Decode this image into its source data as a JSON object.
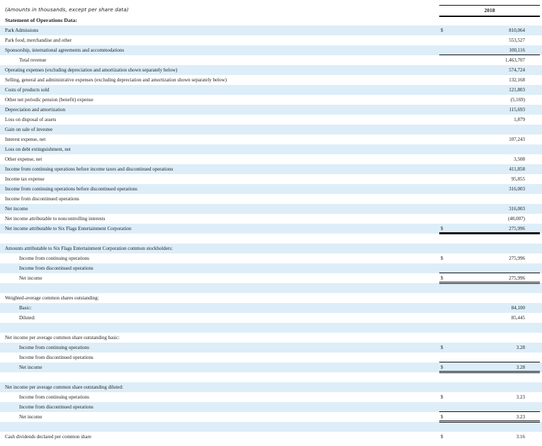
{
  "header": {
    "note": "(Amounts in thousands, except per share data)",
    "year": "2018",
    "section_title": "Statement of Operations Data:"
  },
  "rows": [
    {
      "label": "Park Admissions",
      "currency": "$",
      "value": "810,064",
      "shade": true,
      "indent": 0
    },
    {
      "label": "Park food, merchandise and other",
      "currency": "",
      "value": "553,527",
      "shade": false,
      "indent": 0
    },
    {
      "label": "Sponsorship, international agreements and accommodations",
      "currency": "",
      "value": "100,116",
      "shade": true,
      "indent": 0
    },
    {
      "label": "Total revenue",
      "currency": "",
      "value": "1,463,707",
      "shade": false,
      "indent": 1
    },
    {
      "label": "Operating expenses (excluding depreciation and amortization shown separately below)",
      "currency": "",
      "value": "574,724",
      "shade": true,
      "indent": 0
    },
    {
      "label": "Selling, general and administrative expenses (excluding depreciation and amortization shown separately below)",
      "currency": "",
      "value": "132,168",
      "shade": false,
      "indent": 0
    },
    {
      "label": "Costs of products sold",
      "currency": "",
      "value": "121,803",
      "shade": true,
      "indent": 0
    },
    {
      "label": "Other net periodic pension (benefit) expense",
      "currency": "",
      "value": "(5,169)",
      "shade": false,
      "indent": 0
    },
    {
      "label": "Depreciation and amortization",
      "currency": "",
      "value": "115,693",
      "shade": true,
      "indent": 0
    },
    {
      "label": "Loss on disposal of assets",
      "currency": "",
      "value": "1,879",
      "shade": false,
      "indent": 0
    },
    {
      "label": "Gain on sale of investee",
      "currency": "",
      "value": "",
      "shade": true,
      "indent": 0
    },
    {
      "label": "Interest expense, net",
      "currency": "",
      "value": "107,243",
      "shade": false,
      "indent": 0
    },
    {
      "label": "Loss on debt extinguishment, net",
      "currency": "",
      "value": "",
      "shade": true,
      "indent": 0
    },
    {
      "label": "Other expense, net",
      "currency": "",
      "value": "3,508",
      "shade": false,
      "indent": 0
    },
    {
      "label": "Income from continuing operations before income taxes and discontinued operations",
      "currency": "",
      "value": "411,858",
      "shade": true,
      "indent": 0
    },
    {
      "label": "Income tax expense",
      "currency": "",
      "value": "95,855",
      "shade": false,
      "indent": 0
    },
    {
      "label": "Income from continuing operations before discontinued operations",
      "currency": "",
      "value": "316,003",
      "shade": true,
      "indent": 0
    },
    {
      "label": "Income from discontinued operations",
      "currency": "",
      "value": "",
      "shade": false,
      "indent": 0
    },
    {
      "label": "Net income",
      "currency": "",
      "value": "316,003",
      "shade": true,
      "indent": 0
    },
    {
      "label": "Net income attributable to noncontrolling interests",
      "currency": "",
      "value": "(40,007)",
      "shade": false,
      "indent": 0
    },
    {
      "label": "Net income attributable to Six Flags Entertainment Corporation",
      "currency": "$",
      "value": "275,996",
      "shade": true,
      "indent": 0
    },
    {
      "label": "",
      "currency": "",
      "value": "",
      "shade": false,
      "indent": 0
    },
    {
      "label": "Amounts attributable to Six Flags Entertainment Corporation common stockholders:",
      "currency": "",
      "value": "",
      "shade": true,
      "indent": 0
    },
    {
      "label": "Income from continuing operations",
      "currency": "$",
      "value": "275,996",
      "shade": false,
      "indent": 1
    },
    {
      "label": "Income from discontinued operations",
      "currency": "",
      "value": "",
      "shade": true,
      "indent": 1
    },
    {
      "label": "Net income",
      "currency": "$",
      "value": "275,996",
      "shade": false,
      "indent": 1
    },
    {
      "label": "",
      "currency": "",
      "value": "",
      "shade": true,
      "indent": 0
    },
    {
      "label": "Weighted-average common shares outstanding:",
      "currency": "",
      "value": "",
      "shade": false,
      "indent": 0
    },
    {
      "label": "Basic:",
      "currency": "",
      "value": "84,100",
      "shade": true,
      "indent": 1
    },
    {
      "label": "Diluted:",
      "currency": "",
      "value": "85,445",
      "shade": false,
      "indent": 1
    },
    {
      "label": "",
      "currency": "",
      "value": "",
      "shade": true,
      "indent": 0
    },
    {
      "label": "Net income per average common share outstanding   basic:",
      "currency": "",
      "value": "",
      "shade": false,
      "indent": 0
    },
    {
      "label": "Income from continuing operations",
      "currency": "$",
      "value": "3.28",
      "shade": true,
      "indent": 1
    },
    {
      "label": "Income from discontinued operations",
      "currency": "",
      "value": "",
      "shade": false,
      "indent": 1
    },
    {
      "label": "Net income",
      "currency": "$",
      "value": "3.28",
      "shade": true,
      "indent": 1
    },
    {
      "label": "",
      "currency": "",
      "value": "",
      "shade": false,
      "indent": 0
    },
    {
      "label": "Net income per average common share outstanding   diluted:",
      "currency": "",
      "value": "",
      "shade": true,
      "indent": 0
    },
    {
      "label": "Income from continuing operations",
      "currency": "$",
      "value": "3.23",
      "shade": false,
      "indent": 1
    },
    {
      "label": "Income from discontinued operations",
      "currency": "",
      "value": "",
      "shade": true,
      "indent": 1
    },
    {
      "label": "Net income",
      "currency": "$",
      "value": "3.23",
      "shade": false,
      "indent": 1
    },
    {
      "label": "",
      "currency": "",
      "value": "",
      "shade": true,
      "indent": 0
    },
    {
      "label": "Cash dividends declared per common share",
      "currency": "$",
      "value": "3.16",
      "shade": false,
      "indent": 0
    }
  ]
}
